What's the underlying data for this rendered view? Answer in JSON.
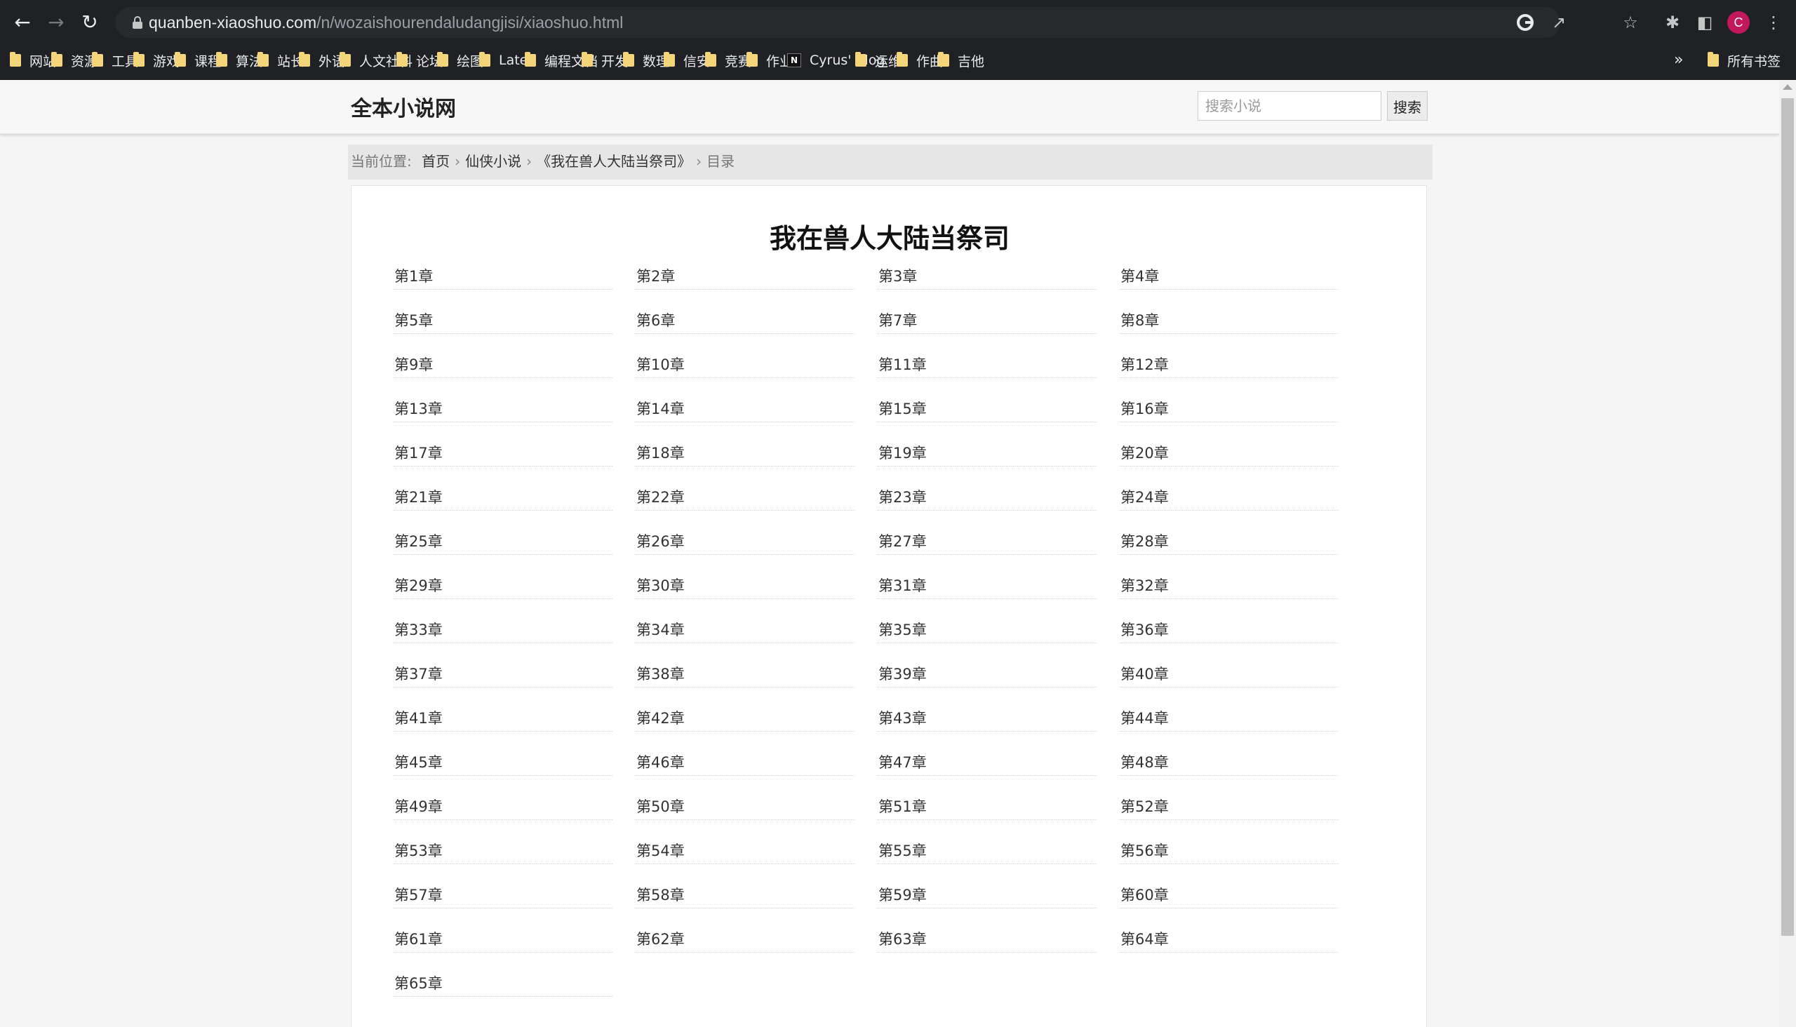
{
  "browser": {
    "url_host": "quanben-xiaoshuo.com",
    "url_path": "/n/wozaishourendaludangjisi/xiaoshuo.html",
    "avatar_letter": "C",
    "bookmarks": [
      {
        "label": "网站",
        "icon": "folder-icon"
      },
      {
        "label": "资源",
        "icon": "folder-icon"
      },
      {
        "label": "工具",
        "icon": "folder-icon"
      },
      {
        "label": "游戏",
        "icon": "folder-icon"
      },
      {
        "label": "课程",
        "icon": "folder-icon"
      },
      {
        "label": "算法",
        "icon": "folder-icon"
      },
      {
        "label": "站长",
        "icon": "folder-icon"
      },
      {
        "label": "外语",
        "icon": "folder-icon"
      },
      {
        "label": "人文社科",
        "icon": "folder-icon"
      },
      {
        "label": "论坛",
        "icon": "folder-icon"
      },
      {
        "label": "绘图",
        "icon": "folder-icon"
      },
      {
        "label": "Latex",
        "icon": "folder-icon"
      },
      {
        "label": "编程文档",
        "icon": "folder-icon"
      },
      {
        "label": "开发",
        "icon": "folder-icon"
      },
      {
        "label": "数理",
        "icon": "folder-icon"
      },
      {
        "label": "信安",
        "icon": "folder-icon"
      },
      {
        "label": "竞赛",
        "icon": "folder-icon"
      },
      {
        "label": "作业",
        "icon": "folder-icon"
      },
      {
        "label": "Cyrus' Blog",
        "icon": "notion-icon"
      },
      {
        "label": "运维",
        "icon": "folder-icon"
      },
      {
        "label": "作曲",
        "icon": "folder-icon"
      },
      {
        "label": "吉他",
        "icon": "folder-icon"
      }
    ],
    "more_label": "»",
    "all_bookmarks_label": "所有书签"
  },
  "site": {
    "title": "全本小说网",
    "search_placeholder": "搜索小说",
    "search_button": "搜索"
  },
  "breadcrumb": {
    "prefix": "当前位置:",
    "items": [
      "首页",
      "仙侠小说",
      "《我在兽人大陆当祭司》"
    ],
    "current": "目录"
  },
  "book": {
    "title": "我在兽人大陆当祭司",
    "chapters": [
      "第1章",
      "第2章",
      "第3章",
      "第4章",
      "第5章",
      "第6章",
      "第7章",
      "第8章",
      "第9章",
      "第10章",
      "第11章",
      "第12章",
      "第13章",
      "第14章",
      "第15章",
      "第16章",
      "第17章",
      "第18章",
      "第19章",
      "第20章",
      "第21章",
      "第22章",
      "第23章",
      "第24章",
      "第25章",
      "第26章",
      "第27章",
      "第28章",
      "第29章",
      "第30章",
      "第31章",
      "第32章",
      "第33章",
      "第34章",
      "第35章",
      "第36章",
      "第37章",
      "第38章",
      "第39章",
      "第40章",
      "第41章",
      "第42章",
      "第43章",
      "第44章",
      "第45章",
      "第46章",
      "第47章",
      "第48章",
      "第49章",
      "第50章",
      "第51章",
      "第52章",
      "第53章",
      "第54章",
      "第55章",
      "第56章",
      "第57章",
      "第58章",
      "第59章",
      "第60章",
      "第61章",
      "第62章",
      "第63章",
      "第64章",
      "第65章"
    ]
  }
}
